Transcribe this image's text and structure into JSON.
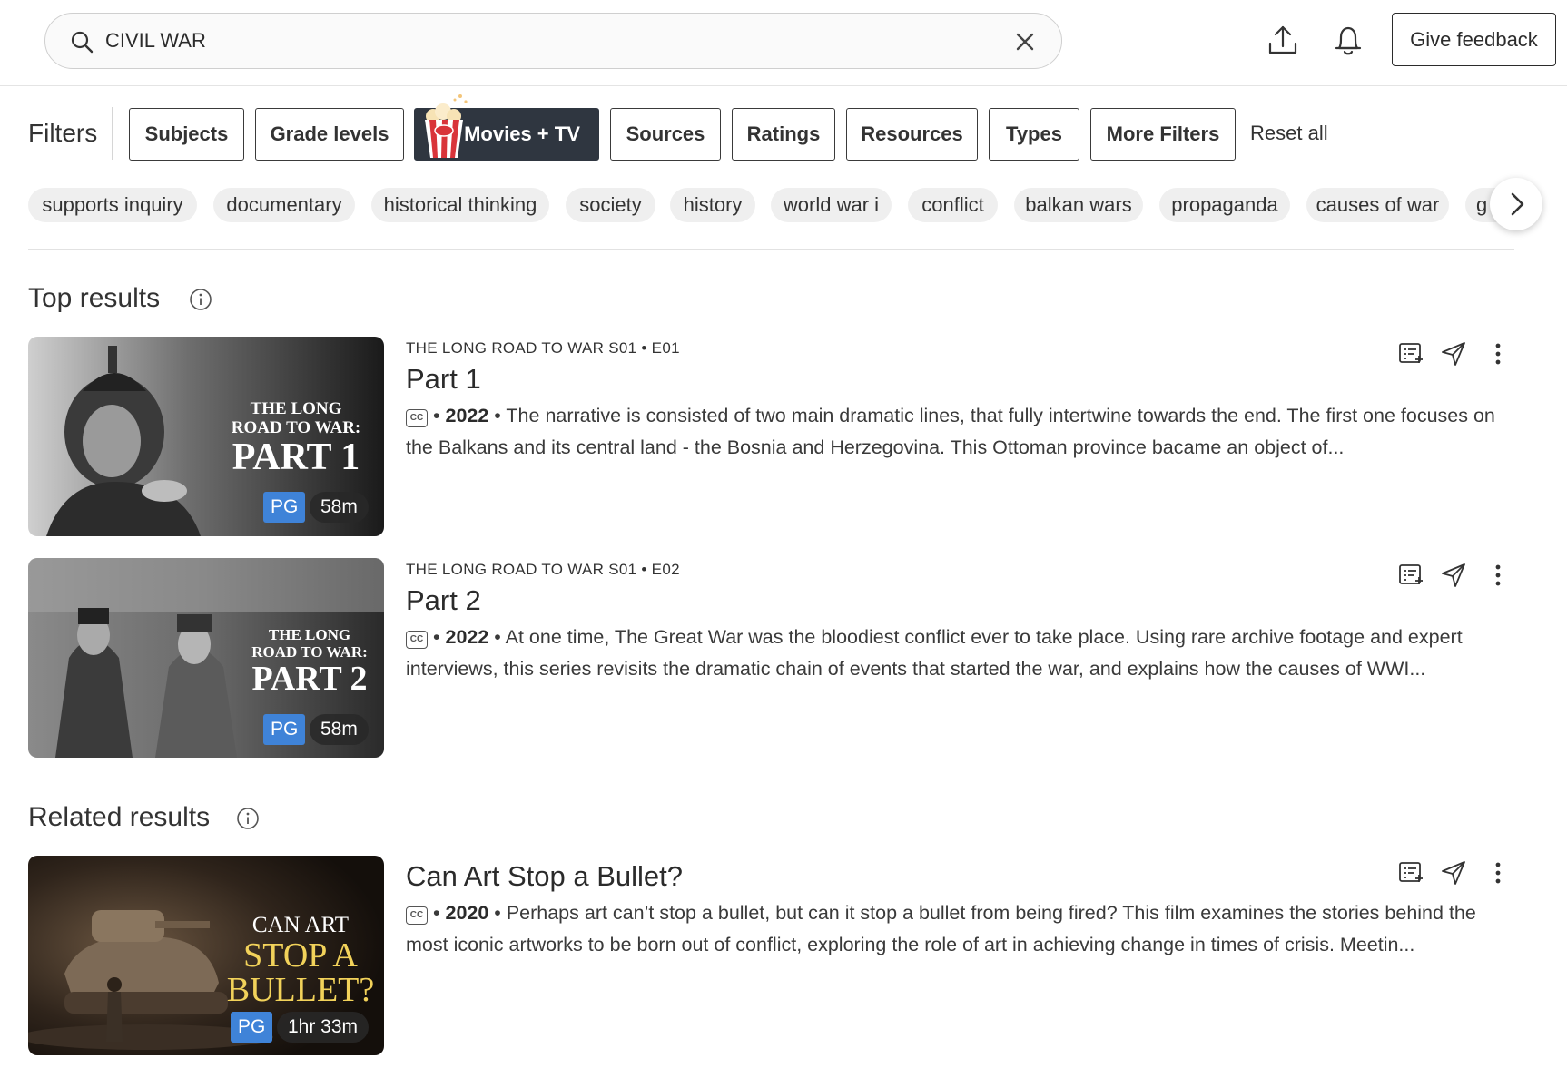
{
  "search": {
    "value": "CIVIL WAR"
  },
  "header": {
    "feedback_label": "Give feedback"
  },
  "filters": {
    "label": "Filters",
    "buttons": [
      "Subjects",
      "Grade levels",
      "Movies + TV",
      "Sources",
      "Ratings",
      "Resources",
      "Types",
      "More Filters"
    ],
    "active": "Movies + TV",
    "reset_label": "Reset all"
  },
  "chips": [
    "supports inquiry",
    "documentary",
    "historical thinking",
    "society",
    "history",
    "world war i",
    "conflict",
    "balkan wars",
    "propaganda",
    "causes of war",
    "g"
  ],
  "top_results": {
    "title": "Top results",
    "items": [
      {
        "series": "THE LONG ROAD TO WAR S01 • E01",
        "title": "Part 1",
        "cc": "CC",
        "year": "2022",
        "description": "The narrative is consisted of two main dramatic lines, that fully intertwine towards the end. The first one focuses on the Balkans and its central land - the Bosnia and Herzegovina. This Ottoman province bacame an object of...",
        "thumb": {
          "line1": "THE LONG",
          "line2": "ROAD TO WAR:",
          "line3": "PART 1",
          "rating": "PG",
          "duration": "58m"
        }
      },
      {
        "series": "THE LONG ROAD TO WAR S01 • E02",
        "title": "Part 2",
        "cc": "CC",
        "year": "2022",
        "description": "At one time, The Great War was the bloodiest conflict ever to take place. Using rare archive footage and expert interviews, this series revisits the dramatic chain of events that started the war, and explains how the causes of WWI...",
        "thumb": {
          "line1": "THE LONG",
          "line2": "ROAD TO WAR:",
          "line3": "PART 2",
          "rating": "PG",
          "duration": "58m"
        }
      }
    ]
  },
  "related_results": {
    "title": "Related results",
    "items": [
      {
        "title": "Can Art Stop a Bullet?",
        "cc": "CC",
        "year": "2020",
        "description": "Perhaps art can’t stop a bullet, but can it stop a bullet from being fired? This film examines the stories behind the most iconic artworks to be born out of conflict, exploring the role of art in achieving change in times of crisis. Meetin...",
        "thumb": {
          "line1": "CAN ART",
          "line2": "STOP A",
          "line3": "BULLET?",
          "rating": "PG",
          "duration": "1hr 33m"
        }
      }
    ]
  },
  "icons": {
    "search": "search-icon",
    "clear": "close-icon",
    "upload": "upload-icon",
    "notifications": "bell-icon",
    "info": "info-icon",
    "add_to_list": "add-to-list-icon",
    "share": "send-icon",
    "more": "more-vertical-icon",
    "next": "chevron-right-icon"
  },
  "colors": {
    "active_filter_bg": "#2f3640",
    "rating_badge": "#3f83d8",
    "thumb_title_yellow": "#f2d25a"
  }
}
